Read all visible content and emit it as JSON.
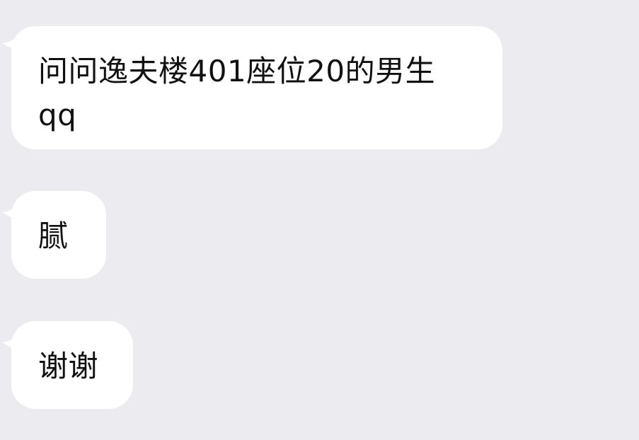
{
  "messages": [
    {
      "text": "问问逸夫楼401座位20的男生qq"
    },
    {
      "text": "腻"
    },
    {
      "text": "谢谢"
    }
  ],
  "colors": {
    "background": "#ebebf0",
    "bubble": "#ffffff",
    "text": "#111111"
  }
}
